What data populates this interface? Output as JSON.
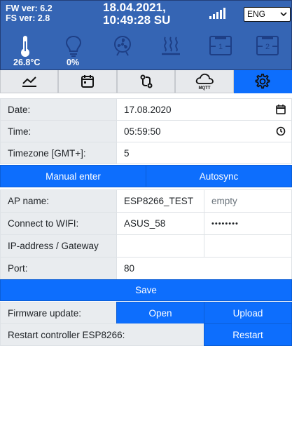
{
  "header": {
    "fw_version": "FW ver: 6.2",
    "fs_version": "FS ver: 2.8",
    "date": "18.04.2021,",
    "time": "10:49:28 SU",
    "language": "ENG",
    "temperature": "26.8°C",
    "light": "0%",
    "relay1": "1",
    "relay2": "2"
  },
  "tabs": [
    "chart-icon",
    "calendar-icon",
    "git-compare-icon",
    "mqtt-cloud-icon",
    "settings-icon"
  ],
  "tab_mqtt_label": "MQTT",
  "form": {
    "date_label": "Date:",
    "date_value": "17.08.2020",
    "time_label": "Time:",
    "time_value": "05:59:50",
    "timezone_label": "Timezone [GMT+]:",
    "timezone_value": "5",
    "manual_enter": "Manual enter",
    "autosync": "Autosync",
    "ap_name_label": "AP name:",
    "ap_name_value": "ESP8266_TEST",
    "ap_password_placeholder": "empty",
    "wifi_label": "Connect to WIFI:",
    "wifi_value": "ASUS_58",
    "wifi_password": "••••••••",
    "ip_label": "IP-address / Gateway",
    "ip_value": "",
    "gateway_value": "",
    "port_label": "Port:",
    "port_value": "80",
    "save": "Save",
    "firmware_label": "Firmware update:",
    "open": "Open",
    "upload": "Upload",
    "restart_label": "Restart controller ESP8266:",
    "restart": "Restart"
  },
  "colors": {
    "header_bg": "#3565b4",
    "accent": "#0d6efd",
    "label_bg": "#e9ecef",
    "tab_bg": "#e7e9ec"
  }
}
